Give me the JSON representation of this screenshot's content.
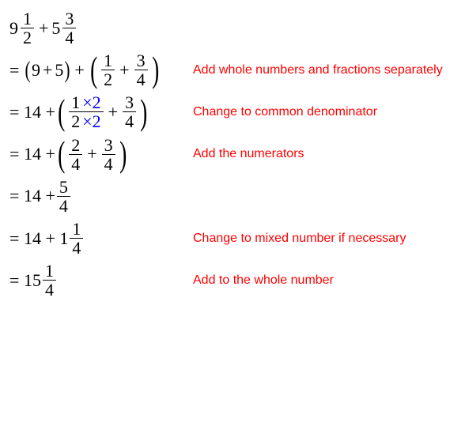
{
  "problem": {
    "a_whole": "9",
    "a_num": "1",
    "a_den": "2",
    "b_whole": "5",
    "b_num": "3",
    "b_den": "4",
    "op": "+"
  },
  "steps": [
    {
      "eq": "=",
      "pre": "",
      "a": "9",
      "op": "+",
      "b": "5",
      "post": "+",
      "f1_num": "1",
      "f1_den": "2",
      "mid": "+",
      "f2_num": "3",
      "f2_den": "4",
      "note": "Add whole numbers and fractions separately"
    },
    {
      "eq": "=",
      "pre": "14 +",
      "f1_num": "1",
      "f1_num_ext": "×2",
      "f1_den": "2",
      "f1_den_ext": "×2",
      "mid": "+",
      "f2_num": "3",
      "f2_den": "4",
      "note": "Change to common denominator"
    },
    {
      "eq": "=",
      "pre": "14 +",
      "f1_num": "2",
      "f1_den": "4",
      "mid": "+",
      "f2_num": "3",
      "f2_den": "4",
      "note": "Add the numerators"
    },
    {
      "eq": "=",
      "pre": "14 +",
      "f1_num": "5",
      "f1_den": "4",
      "note": ""
    },
    {
      "eq": "=",
      "pre": "14 + 1",
      "f1_num": "1",
      "f1_den": "4",
      "note": "Change to mixed number if necessary"
    },
    {
      "eq": "=",
      "pre": "15",
      "f1_num": "1",
      "f1_den": "4",
      "note": "Add to the whole number"
    }
  ]
}
